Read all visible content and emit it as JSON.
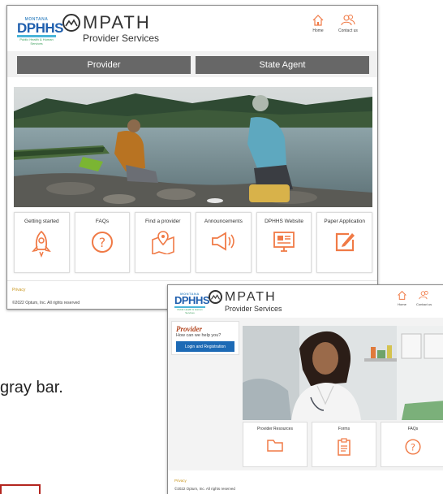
{
  "screen1": {
    "logo": {
      "top": "MONTANA",
      "main": "DPHHS",
      "sub": "Public Health & Human Services"
    },
    "brand": {
      "title": "MPATH",
      "subtitle": "Provider Services"
    },
    "header_nav": [
      {
        "label": "Home",
        "icon": "home-icon"
      },
      {
        "label": "Contact us",
        "icon": "contact-users-icon"
      }
    ],
    "tabs": [
      "Provider",
      "State Agent"
    ],
    "tiles": [
      {
        "label": "Getting started",
        "icon": "rocket-icon"
      },
      {
        "label": "FAQs",
        "icon": "question-circle-icon"
      },
      {
        "label": "Find a provider",
        "icon": "map-location-icon"
      },
      {
        "label": "Announcements",
        "icon": "megaphone-icon"
      },
      {
        "label": "DPHHS Website",
        "icon": "website-icon"
      },
      {
        "label": "Paper Application",
        "icon": "edit-document-icon"
      }
    ],
    "footer": {
      "link": "Privacy",
      "copyright": "©2022 Optum, Inc. All rights reserved"
    },
    "accent_color": "#f07a46"
  },
  "screen2": {
    "logo": {
      "top": "MONTANA",
      "main": "DPHHS",
      "sub": "Public Health & Human Services"
    },
    "brand": {
      "title": "MPATH",
      "subtitle": "Provider Services"
    },
    "header_nav": [
      {
        "label": "Home",
        "icon": "home-icon"
      },
      {
        "label": "Contact us",
        "icon": "contact-users-icon"
      }
    ],
    "provider_card": {
      "title": "Provider",
      "subtitle": "How can we help you?",
      "button": "Login and Registration"
    },
    "tiles": [
      {
        "label": "Provider Resources",
        "icon": "folder-icon"
      },
      {
        "label": "Forms",
        "icon": "clipboard-icon"
      },
      {
        "label": "FAQs",
        "icon": "question-circle-icon"
      }
    ],
    "footer": {
      "link": "Privacy",
      "copyright": "©2022 Optum, Inc. All rights reserved"
    }
  },
  "background_text": "gray bar."
}
